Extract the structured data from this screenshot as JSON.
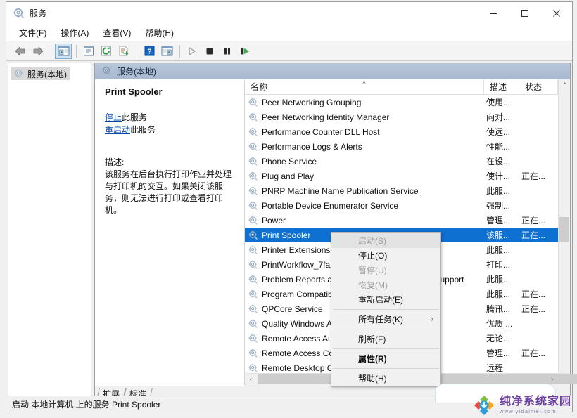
{
  "window": {
    "title": "服务",
    "icon": "services-gear-icon",
    "buttons": {
      "minimize": "—",
      "maximize": "□",
      "close": "✕"
    }
  },
  "menubar": [
    {
      "label": "文件(F)",
      "name": "menu-file"
    },
    {
      "label": "操作(A)",
      "name": "menu-action"
    },
    {
      "label": "查看(V)",
      "name": "menu-view"
    },
    {
      "label": "帮助(H)",
      "name": "menu-help"
    }
  ],
  "toolbar": [
    {
      "name": "back-icon",
      "tip": "后退"
    },
    {
      "name": "forward-icon",
      "tip": "前进"
    },
    {
      "name": "show-console-tree-icon",
      "tip": "显示/隐藏控制台树"
    },
    {
      "name": "properties-icon",
      "tip": "属性"
    },
    {
      "name": "refresh-icon",
      "tip": "刷新"
    },
    {
      "name": "export-list-icon",
      "tip": "导出列表"
    },
    {
      "name": "help-icon",
      "tip": "帮助"
    },
    {
      "name": "show-action-pane-icon",
      "tip": "显示/隐藏操作窗格"
    },
    {
      "name": "start-service-icon",
      "tip": "启动服务"
    },
    {
      "name": "stop-service-icon",
      "tip": "停止服务"
    },
    {
      "name": "pause-service-icon",
      "tip": "暂停服务"
    },
    {
      "name": "restart-service-icon",
      "tip": "重启服务"
    }
  ],
  "tree": {
    "items": [
      {
        "label": "服务(本地)",
        "name": "tree-item-services-local"
      }
    ]
  },
  "result_header": {
    "label": "服务(本地)"
  },
  "detail": {
    "title": "Print Spooler",
    "links": [
      {
        "link_text": "停止",
        "suffix": "此服务",
        "name": "stop-service-link"
      },
      {
        "link_text": "重启动",
        "suffix": "此服务",
        "name": "restart-service-link"
      }
    ],
    "desc_label": "描述:",
    "desc_text": "该服务在后台执行打印作业并处理与打印机的交互。如果关闭该服务，则无法进行打印或查看打印机。"
  },
  "list": {
    "columns": [
      {
        "label": "名称",
        "name": "column-name",
        "sorted": true,
        "sort_glyph": "^"
      },
      {
        "label": "描述",
        "name": "column-description"
      },
      {
        "label": "状态",
        "name": "column-status"
      }
    ],
    "rows": [
      {
        "name": "Peer Networking Grouping",
        "desc": "使用...",
        "status": ""
      },
      {
        "name": "Peer Networking Identity Manager",
        "desc": "向对...",
        "status": ""
      },
      {
        "name": "Performance Counter DLL Host",
        "desc": "使远...",
        "status": ""
      },
      {
        "name": "Performance Logs & Alerts",
        "desc": "性能...",
        "status": ""
      },
      {
        "name": "Phone Service",
        "desc": "在设...",
        "status": ""
      },
      {
        "name": "Plug and Play",
        "desc": "使计...",
        "status": "正在..."
      },
      {
        "name": "PNRP Machine Name Publication Service",
        "desc": "此服...",
        "status": ""
      },
      {
        "name": "Portable Device Enumerator Service",
        "desc": "强制...",
        "status": ""
      },
      {
        "name": "Power",
        "desc": "管理...",
        "status": "正在..."
      },
      {
        "name": "Print Spooler",
        "desc": "该服...",
        "status": "正在...",
        "selected": true
      },
      {
        "name": "Printer Extensions and Notifications",
        "desc": "此服...",
        "status": ""
      },
      {
        "name": "PrintWorkflow_7fa25",
        "desc": "打印...",
        "status": ""
      },
      {
        "name": "Problem Reports and Solutions Control Panel Support",
        "desc": "此服...",
        "status": ""
      },
      {
        "name": "Program Compatibility Assistant Service",
        "desc": "此服...",
        "status": "正在..."
      },
      {
        "name": "QPCore Service",
        "desc": "腾讯...",
        "status": "正在..."
      },
      {
        "name": "Quality Windows Audio Video Experience",
        "desc": "优质 ...",
        "status": ""
      },
      {
        "name": "Remote Access Auto Connection Manager",
        "desc": "无论...",
        "status": ""
      },
      {
        "name": "Remote Access Connection Manager",
        "desc": "管理...",
        "status": "正在..."
      },
      {
        "name": "Remote Desktop Configuration",
        "desc": "远程",
        "status": ""
      }
    ]
  },
  "context_menu": {
    "items": [
      {
        "label": "启动(S)",
        "name": "ctx-start",
        "disabled": true,
        "hover": true
      },
      {
        "label": "停止(O)",
        "name": "ctx-stop",
        "disabled": false
      },
      {
        "label": "暂停(U)",
        "name": "ctx-pause",
        "disabled": true
      },
      {
        "label": "恢复(M)",
        "name": "ctx-resume",
        "disabled": true
      },
      {
        "label": "重新启动(E)",
        "name": "ctx-restart",
        "disabled": false
      },
      {
        "separator": true
      },
      {
        "label": "所有任务(K)",
        "name": "ctx-all-tasks",
        "submenu": true,
        "sub_glyph": "›"
      },
      {
        "separator": true
      },
      {
        "label": "刷新(F)",
        "name": "ctx-refresh"
      },
      {
        "separator": true
      },
      {
        "label": "属性(R)",
        "name": "ctx-properties",
        "bold": true
      },
      {
        "separator": true
      },
      {
        "label": "帮助(H)",
        "name": "ctx-help"
      }
    ]
  },
  "tabs": [
    {
      "label": "扩展",
      "name": "tab-extended"
    },
    {
      "label": "标准",
      "name": "tab-standard"
    }
  ],
  "statusbar": {
    "text": "启动 本地计算机 上的服务 Print Spooler"
  },
  "watermark": {
    "main": "纯净系统家园",
    "sub": "www.yidaimei.com"
  },
  "scrollbars": {
    "vertical": {
      "up_glyph": "⌃",
      "down_glyph": "⌄"
    },
    "horizontal": {
      "left_glyph": "‹",
      "right_glyph": "›"
    }
  },
  "colors": {
    "selection": "#0e70d1",
    "header_band": "#a9b9d0",
    "link": "#0645ad",
    "watermark": "#6b3fa0"
  }
}
